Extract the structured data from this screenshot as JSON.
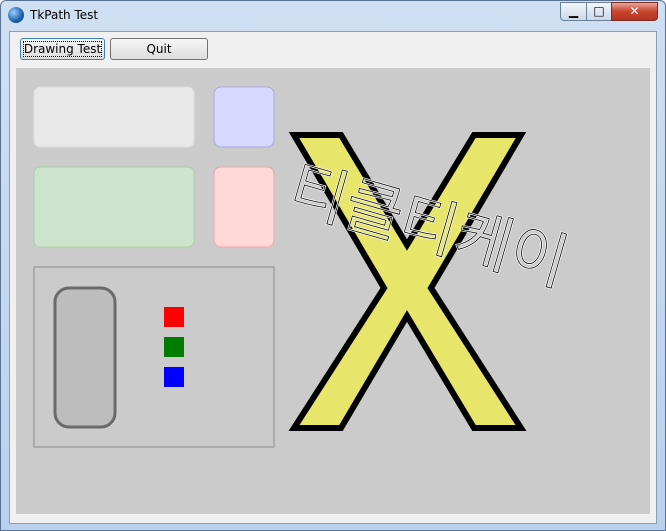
{
  "window": {
    "title": "TkPath Test"
  },
  "title_controls": {
    "minimize_glyph": "▁",
    "maximize_glyph": "□",
    "close_glyph": "✕"
  },
  "toolbar": {
    "drawing_test_label": "Drawing Test",
    "quit_label": "Quit"
  },
  "canvas": {
    "korean_text": "티클티케이",
    "big_letter": "X",
    "colors": {
      "background": "#cbcbcb",
      "gray_box": "#e8e8e8",
      "blue_box": "#d8d8ff",
      "green_box": "#cce4cc",
      "pink_box": "#ffd8d8",
      "square_red": "#ff0000",
      "square_green": "#007d00",
      "square_blue": "#0000ff",
      "x_fill": "#e8e66a"
    }
  }
}
